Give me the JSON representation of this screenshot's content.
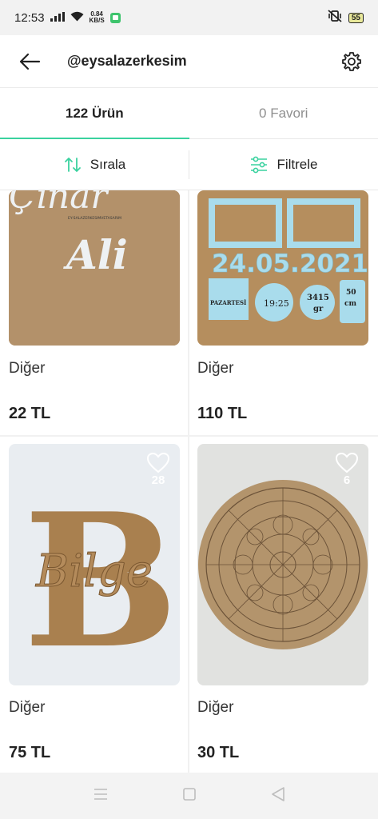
{
  "status": {
    "time": "12:53",
    "netspeed_value": "0.84",
    "netspeed_unit": "KB/S",
    "battery": "55"
  },
  "header": {
    "title": "@eysalazerkesim"
  },
  "tabs": [
    {
      "label": "122 Ürün",
      "active": true
    },
    {
      "label": "0 Favori",
      "active": false
    }
  ],
  "actions": {
    "sort_label": "Sırala",
    "filter_label": "Filtrele"
  },
  "products": [
    {
      "category": "Diğer",
      "price": "22 TL",
      "image_text": {
        "line1": "Çınar",
        "line2": "Ali",
        "watermark": "EY-SALAZERKESIMVETASARIM"
      }
    },
    {
      "category": "Diğer",
      "price": "110 TL",
      "image_text": {
        "date": "24.05.2021",
        "weekday": "PAZARTESİ",
        "time": "19:25",
        "weight": "3415",
        "weight_unit": "gr",
        "length": "50",
        "length_unit": "cm"
      }
    },
    {
      "category": "Diğer",
      "price": "75 TL",
      "favorites": "28",
      "image_text": {
        "letter": "B",
        "script": "Bilge"
      }
    },
    {
      "category": "Diğer",
      "price": "30 TL",
      "favorites": "6",
      "image_text": {}
    }
  ],
  "colors": {
    "accent": "#3ad29f",
    "wood": "#b08b62",
    "paper": "#e9edf1",
    "sky_blue": "#a9dcec"
  }
}
